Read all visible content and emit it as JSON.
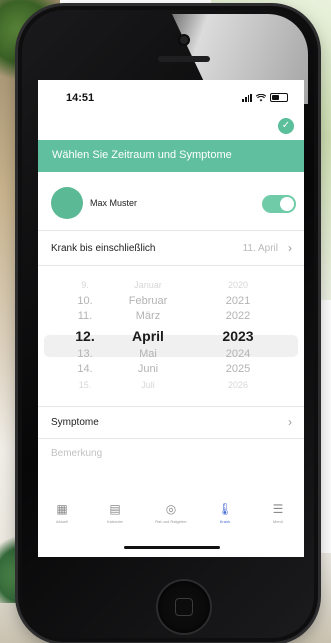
{
  "status_bar": {
    "time": "14:51"
  },
  "header": {
    "banner_text": "Wählen Sie Zeitraum und Symptome"
  },
  "user": {
    "name": "Max Muster",
    "toggle_on": true
  },
  "krank": {
    "label": "Krank bis einschließlich",
    "value": "11. April"
  },
  "picker": {
    "days": [
      "9.",
      "10.",
      "11.",
      "12.",
      "13.",
      "14.",
      "15."
    ],
    "months": [
      "Januar",
      "Februar",
      "März",
      "April",
      "Mai",
      "Juni",
      "Juli"
    ],
    "years": [
      "2020",
      "2021",
      "2022",
      "2023",
      "2024",
      "2025",
      "2026"
    ],
    "selected": {
      "day": "12.",
      "month": "April",
      "year": "2023"
    }
  },
  "symptome": {
    "label": "Symptome"
  },
  "bemerkung": {
    "placeholder": "Bemerkung"
  },
  "tabs": [
    {
      "label": "Aktuell",
      "icon": "grid-icon"
    },
    {
      "label": "Kalender",
      "icon": "calendar-icon"
    },
    {
      "label": "Rat und Ratgeber",
      "icon": "circle-icon"
    },
    {
      "label": "Krank",
      "icon": "thermometer-icon",
      "active": true
    },
    {
      "label": "Menü",
      "icon": "menu-icon"
    }
  ],
  "colors": {
    "accent": "#5fbf9e",
    "tab_active": "#4b6fd6"
  }
}
